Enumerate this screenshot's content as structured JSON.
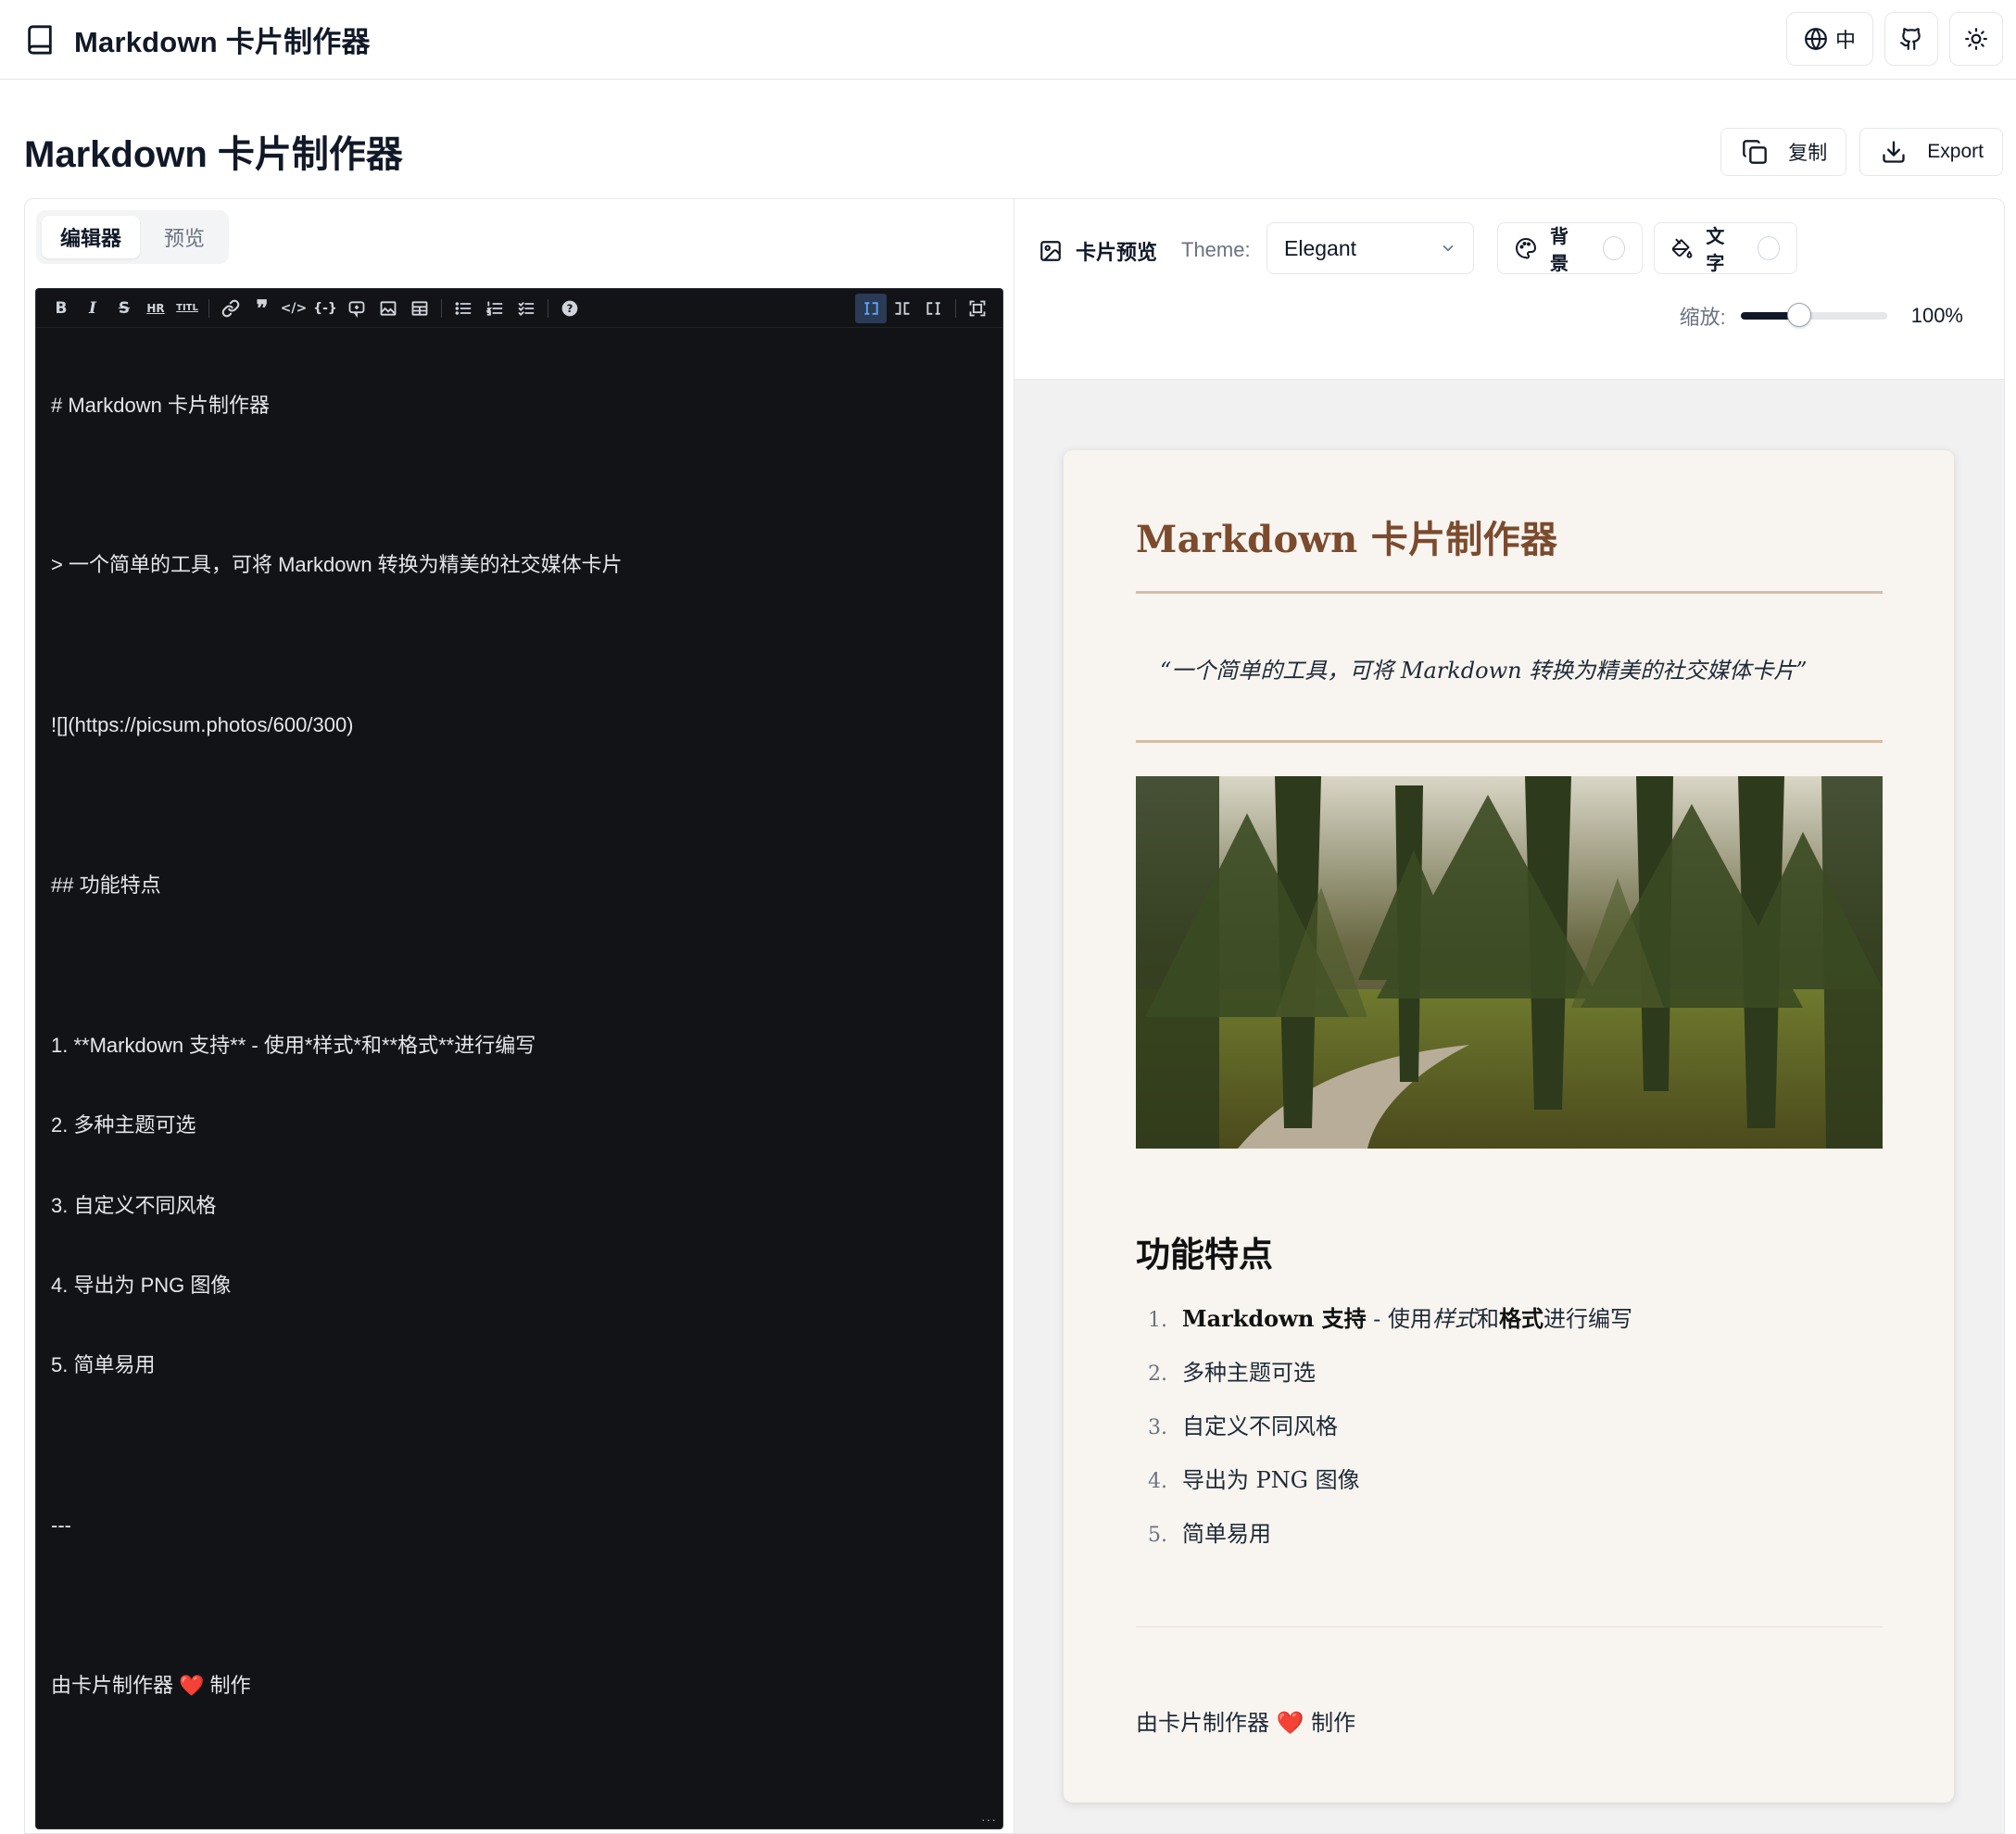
{
  "app": {
    "title": "Markdown 卡片制作器",
    "lang_label": "中"
  },
  "page": {
    "title": "Markdown 卡片制作器",
    "copy_label": "复制",
    "export_label": "Export"
  },
  "tabs": [
    {
      "label": "编辑器",
      "active": true
    },
    {
      "label": "预览",
      "active": false
    }
  ],
  "toolbar": {
    "icons": [
      "bold-icon",
      "italic-icon",
      "strikethrough-icon",
      "hr-icon",
      "title-icon",
      "link-icon",
      "quote-icon",
      "code-icon",
      "code-block-icon",
      "comment-icon",
      "image-icon",
      "table-icon",
      "unordered-list-icon",
      "ordered-list-icon",
      "task-list-icon",
      "help-icon",
      "edit-mode-icon",
      "split-mode-icon",
      "preview-mode-icon",
      "fullscreen-icon"
    ]
  },
  "editor": {
    "lines": [
      "# Markdown 卡片制作器",
      "",
      "> 一个简单的工具，可将 Markdown 转换为精美的社交媒体卡片",
      "",
      "![](https://picsum.photos/600/300)",
      "",
      "## 功能特点",
      "",
      "1. **Markdown 支持** - 使用*样式*和**格式**进行编写",
      "2. 多种主题可选",
      "3. 自定义不同风格",
      "4. 导出为 PNG 图像",
      "5. 简单易用",
      "",
      "---",
      "",
      "由卡片制作器 ❤️ 制作"
    ]
  },
  "preview_panel": {
    "label": "卡片预览",
    "theme_label": "Theme:",
    "theme_value": "Elegant",
    "background_label": "背景",
    "text_label": "文字",
    "zoom_label": "缩放:",
    "zoom_value": "100%",
    "zoom_fraction": 0.4
  },
  "card": {
    "title": "Markdown 卡片制作器",
    "quote": "“一个简单的工具，可将 Markdown 转换为精美的社交媒体卡片”",
    "subheading": "功能特点",
    "list": [
      {
        "num": "1.",
        "bold1": "Markdown 支持",
        "text1": " - 使用",
        "italic": "样式",
        "text2": "和",
        "bold2": "格式",
        "text3": "进行编写"
      },
      {
        "num": "2.",
        "text": "多种主题可选"
      },
      {
        "num": "3.",
        "text": "自定义不同风格"
      },
      {
        "num": "4.",
        "text": "导出为 PNG 图像"
      },
      {
        "num": "5.",
        "text": "简单易用"
      }
    ],
    "footer_before": "由卡片制作器 ",
    "footer_heart": "❤️",
    "footer_after": " 制作"
  },
  "colors": {
    "accent_title": "#7c4a2d",
    "card_bg": "#f8f5f0",
    "editor_bg": "#111317"
  }
}
